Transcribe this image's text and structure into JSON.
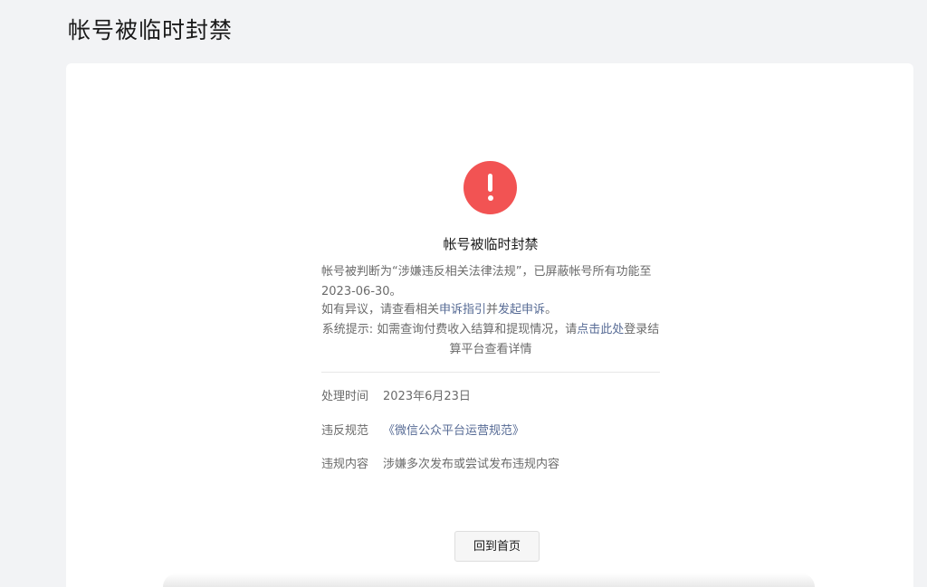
{
  "page": {
    "title": "帐号被临时封禁"
  },
  "notice": {
    "icon": "warning-icon",
    "icon_color": "#f25353",
    "title": "帐号被临时封禁",
    "desc_line1_part1": "帐号被判断为“涉嫌违反相关法律法规”，已屏蔽帐号所有功能至2023-06-30。",
    "desc_line2_prefix": "如有异议，请查看相关",
    "appeal_guide_link": "申诉指引",
    "desc_line2_mid": "并",
    "appeal_link": "发起申诉",
    "desc_line2_suffix": "。",
    "system_tip_prefix": "系统提示: 如需查询付费收入结算和提现情况，请",
    "click_here_link": "点击此处",
    "system_tip_suffix": "登录结算平台查看详情"
  },
  "details": {
    "time_label": "处理时间",
    "time_value": "2023年6月23日",
    "rule_label": "违反规范",
    "rule_value": "《微信公众平台运营规范》",
    "content_label": "违规内容",
    "content_value": "涉嫌多次发布或尝试发布违规内容"
  },
  "actions": {
    "home_button": "回到首页"
  },
  "colors": {
    "link": "#576b95",
    "background": "#f2f3f5",
    "card": "#ffffff"
  }
}
